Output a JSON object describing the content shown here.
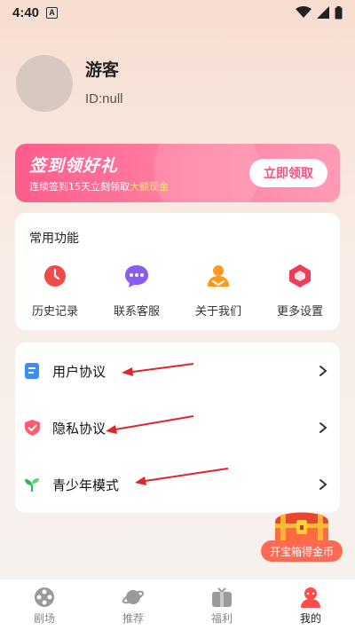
{
  "status_bar": {
    "time": "4:40",
    "notification_glyph": "A"
  },
  "profile": {
    "username": "游客",
    "user_id": "ID:null"
  },
  "signin_banner": {
    "title": "签到领好礼",
    "subtitle_prefix": "连续签到15天立刻领取",
    "subtitle_highlight": "大额现金",
    "button_label": "立即领取"
  },
  "features": {
    "title": "常用功能",
    "items": [
      {
        "label": "历史记录",
        "icon": "clock-icon"
      },
      {
        "label": "联系客服",
        "icon": "chat-icon"
      },
      {
        "label": "关于我们",
        "icon": "people-icon"
      },
      {
        "label": "更多设置",
        "icon": "hexagon-settings-icon"
      }
    ]
  },
  "list": {
    "items": [
      {
        "label": "用户协议",
        "icon": "document-icon"
      },
      {
        "label": "隐私协议",
        "icon": "shield-check-icon"
      },
      {
        "label": "青少年模式",
        "icon": "sprout-icon"
      }
    ]
  },
  "treasure": {
    "label": "开宝箱得金币"
  },
  "tabbar": {
    "tabs": [
      {
        "label": "剧场",
        "icon": "film-reel-icon"
      },
      {
        "label": "推荐",
        "icon": "planet-icon"
      },
      {
        "label": "福利",
        "icon": "tv-gift-icon"
      },
      {
        "label": "我的",
        "icon": "user-icon"
      }
    ]
  },
  "colors": {
    "accent_pink": "#ff5c8a",
    "highlight_yellow": "#ffe37a",
    "arrow_red": "#e0242a",
    "treasure_orange": "#ff6a55"
  }
}
